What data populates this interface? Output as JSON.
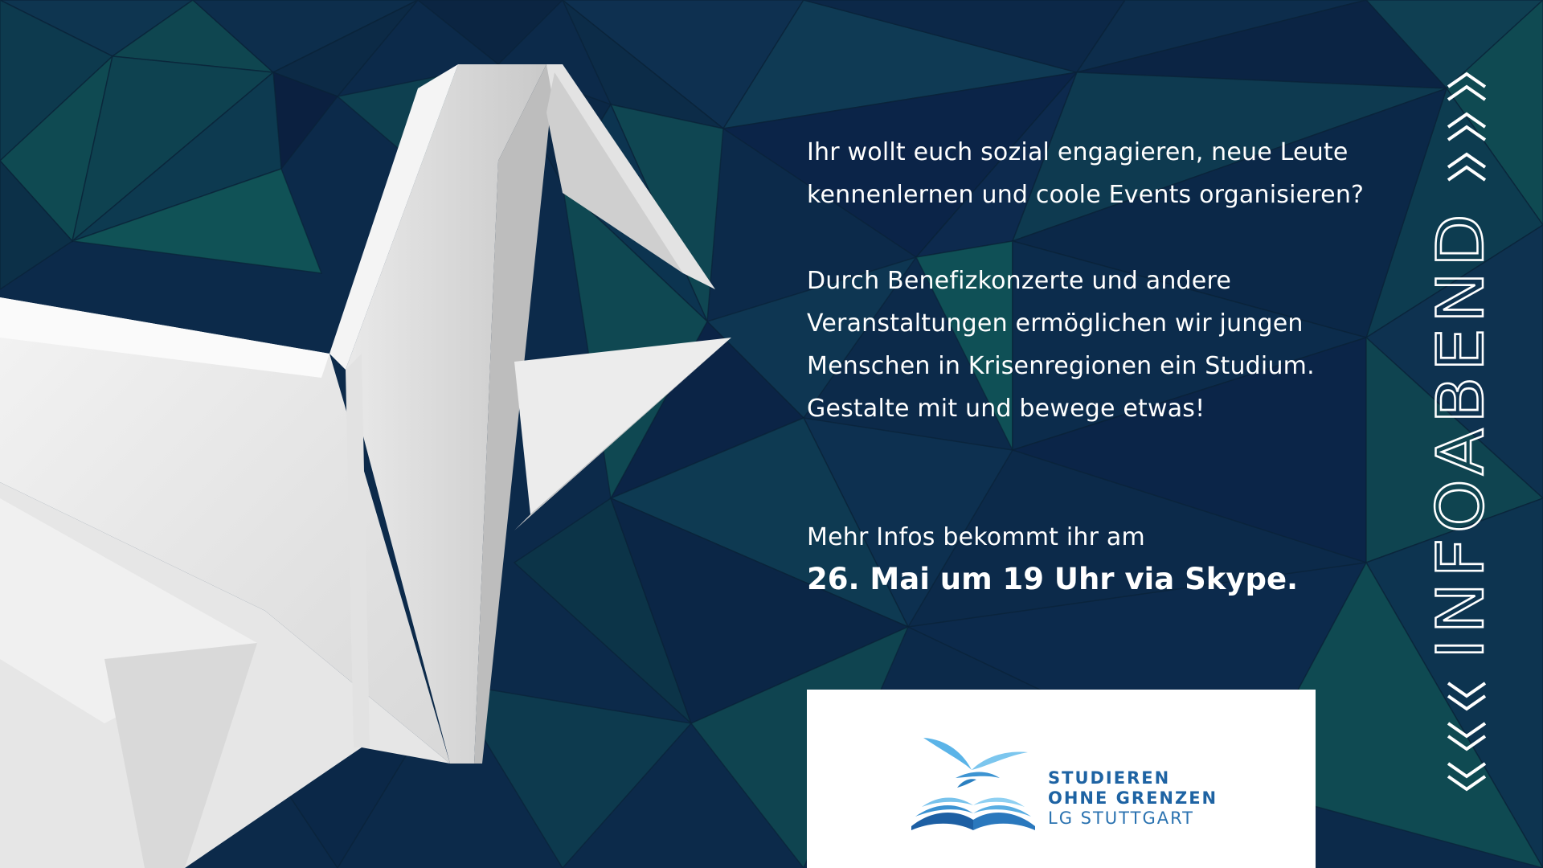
{
  "intro": {
    "line1": "Ihr wollt euch sozial engagieren, neue Leute",
    "line2": "kennenlernen und coole Events organisieren?"
  },
  "details": {
    "line1": "Durch Benefizkonzerte und andere",
    "line2": "Veranstaltungen ermöglichen wir jungen",
    "line3": "Menschen in Krisenregionen ein Studium.",
    "line4": "Gestalte mit und bewege etwas!"
  },
  "event": {
    "lead": "Mehr Infos bekommt ihr am",
    "date": "26. Mai um 19 Uhr via Skype."
  },
  "logo": {
    "line1": "STUDIEREN",
    "line2": "OHNE GRENZEN",
    "line3": "LG STUTTGART"
  },
  "side_title": "INFOABEND",
  "colors": {
    "background_dark": "#0c2a4a",
    "background_teal": "#0f4a52",
    "text": "#ffffff",
    "logo_blue": "#1e63a3",
    "logo_light_blue": "#5bb4e8"
  },
  "icons": [
    "origami-crane-icon",
    "chevron-up-icon",
    "chevron-down-icon",
    "bird-book-logo-icon"
  ]
}
